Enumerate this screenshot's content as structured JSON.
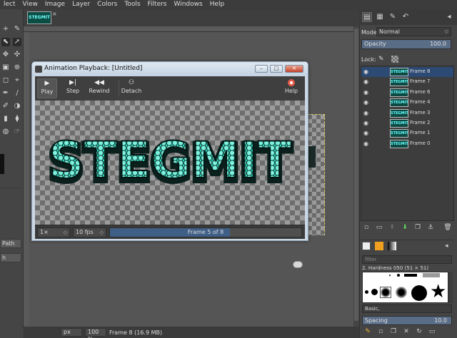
{
  "menubar": [
    "lect",
    "View",
    "Image",
    "Layer",
    "Colors",
    "Tools",
    "Filters",
    "Windows",
    "Help"
  ],
  "toolbox": {
    "path_button": "Path",
    "lower_button": "h"
  },
  "image_tab": {
    "thumb_text": "STEGMIT",
    "close_glyph": "×"
  },
  "statusbar": {
    "unit": "px",
    "zoom": "100 %",
    "status": "Frame 8 (16.9 MB)"
  },
  "dialog": {
    "title": "Animation Playback: [Untitled]",
    "buttons": [
      {
        "label": "Play",
        "icon": "play-icon"
      },
      {
        "label": "Step",
        "icon": "step-icon"
      },
      {
        "label": "Rewind",
        "icon": "rewind-icon"
      },
      {
        "label": "Detach",
        "icon": "detach-icon"
      },
      {
        "label": "Help",
        "icon": "help-icon"
      }
    ],
    "preview_text": "STEGMIT",
    "speed": "1×",
    "fps": "10 fps",
    "frame_status": "Frame 5 of 8",
    "frame_progress": 0.625,
    "text_color": "#3be0c3"
  },
  "layers_panel": {
    "mode_label": "Mode:",
    "mode_value": "Normal",
    "opacity_label": "Opacity",
    "opacity_value": "100.0",
    "lock_label": "Lock:",
    "layers": [
      {
        "name": "Frame 8",
        "selected": true
      },
      {
        "name": "Frame 7",
        "selected": false
      },
      {
        "name": "Frame 6",
        "selected": false
      },
      {
        "name": "Frame 4",
        "selected": false
      },
      {
        "name": "Frame 3",
        "selected": false
      },
      {
        "name": "Frame 2",
        "selected": false
      },
      {
        "name": "Frame 1",
        "selected": false
      },
      {
        "name": "Frame 0",
        "selected": false
      }
    ],
    "thumb_text": "STEGMIT"
  },
  "brushes_panel": {
    "filter_placeholder": "filter",
    "brush_name": "2. Hardness 050 (51 × 51)",
    "tag": "Basic,",
    "spacing_label": "Spacing",
    "spacing_value": "10.0"
  }
}
